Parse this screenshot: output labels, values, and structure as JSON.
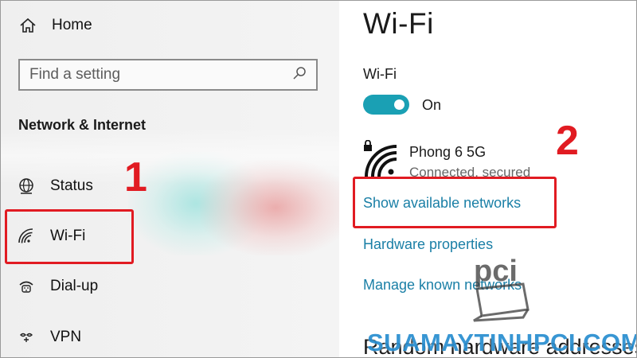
{
  "nav": {
    "home_label": "Home",
    "search_placeholder": "Find a setting",
    "section_title": "Network & Internet",
    "items": [
      {
        "label": "Status",
        "icon": "globe-icon"
      },
      {
        "label": "Wi-Fi",
        "icon": "wifi-icon"
      },
      {
        "label": "Dial-up",
        "icon": "dialup-icon"
      },
      {
        "label": "VPN",
        "icon": "vpn-icon"
      }
    ]
  },
  "content": {
    "title": "Wi-Fi",
    "toggle_label": "Wi-Fi",
    "toggle_state": "On",
    "network": {
      "name": "Phong 6 5G",
      "status": "Connected, secured"
    },
    "links": {
      "show_networks": "Show available networks",
      "hardware": "Hardware properties",
      "manage": "Manage known networks"
    },
    "section2_title": "Random hardware addresses"
  },
  "annotations": {
    "step1": "1",
    "step2": "2"
  },
  "watermark": {
    "text": "SUAMAYTINHPCI.COM",
    "logo": "pci"
  },
  "colors": {
    "accent": "#1aa0b4",
    "link": "#1a7fa6",
    "annotation": "#e11b22",
    "watermark": "#2a8fd0"
  }
}
